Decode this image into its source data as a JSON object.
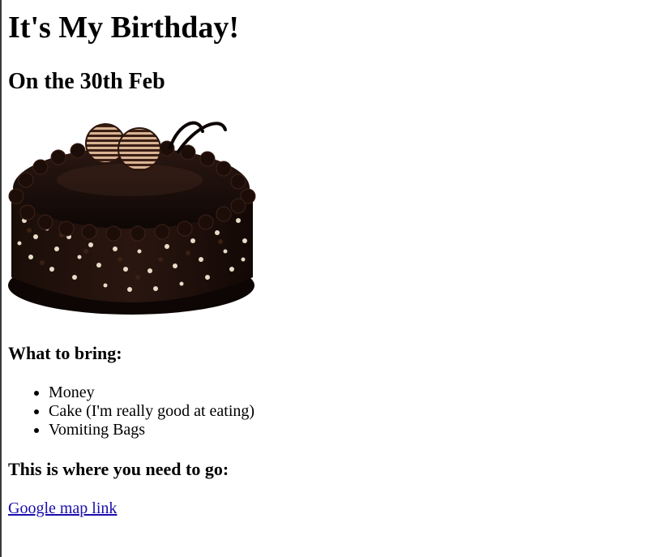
{
  "page": {
    "title": "It's My Birthday!",
    "subtitle": "On the 30th Feb"
  },
  "image": {
    "icon": "chocolate-cake-image"
  },
  "bring": {
    "heading": "What to bring:",
    "items": [
      "Money",
      "Cake (I'm really good at eating)",
      "Vomiting Bags"
    ]
  },
  "location": {
    "heading": "This is where you need to go:",
    "link_label": "Google map link"
  },
  "colors": {
    "link": "#1a0dab",
    "text": "#000000",
    "background": "#ffffff"
  }
}
